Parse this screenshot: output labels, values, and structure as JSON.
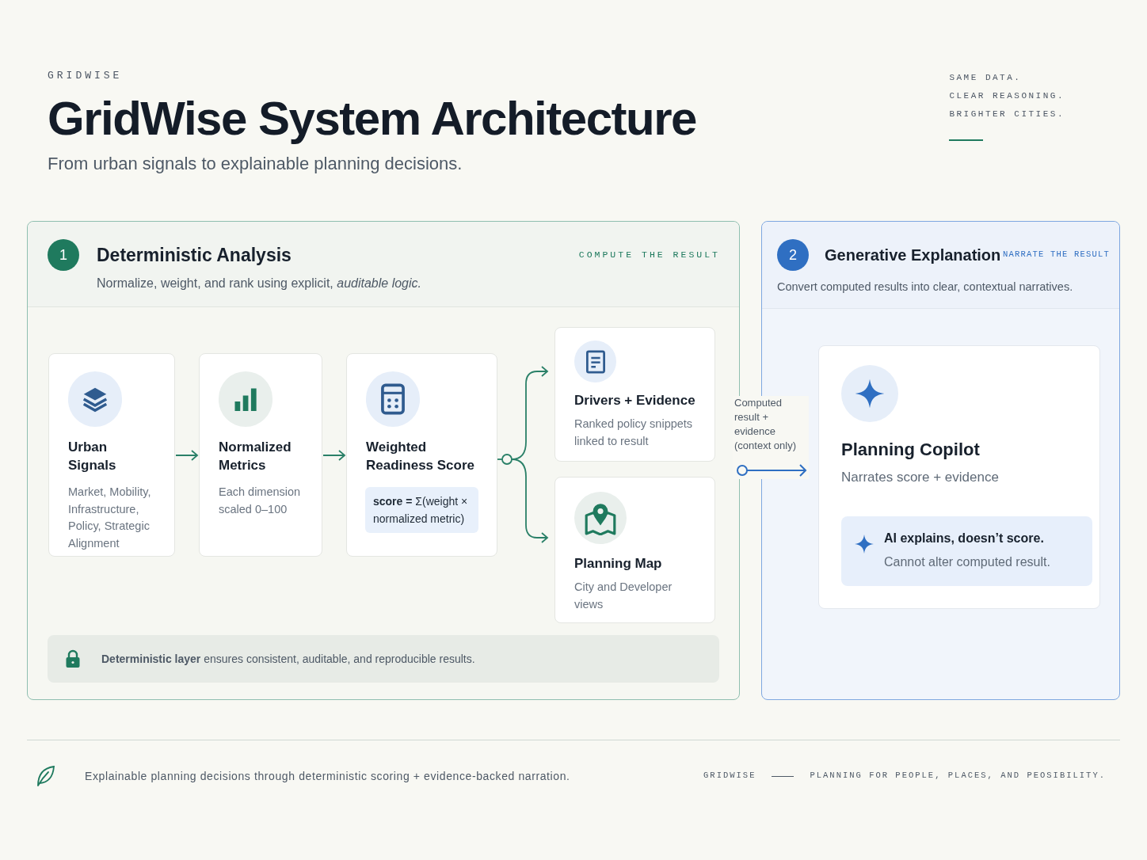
{
  "brand": "GRIDWISE",
  "title": "GridWise System Architecture",
  "subtitle": "From urban signals to explainable planning decisions.",
  "tagline": [
    "SAME DATA.",
    "CLEAR REASONING.",
    "BRIGHTER CITIES."
  ],
  "analysis": {
    "number": "1",
    "title": "Deterministic Analysis",
    "tag": "COMPUTE THE RESULT",
    "description": "Normalize, weight, and rank using explicit, *auditable logic.*",
    "steps": [
      {
        "title": "Urban Signals",
        "description": "Market, Mobility, Infrastructure, Policy, Strategic Alignment"
      },
      {
        "title": "Normalized Metrics",
        "description": "Each dimension scaled 0–100"
      },
      {
        "title": "Weighted Readiness Score",
        "formula": "**score =** Σ(weight × normalized metric)"
      }
    ],
    "outputs": [
      {
        "title": "Drivers + Evidence",
        "description": "Ranked policy snippets linked to result"
      },
      {
        "title": "Planning Map",
        "description": "City and Developer views"
      }
    ],
    "note": "**Deterministic layer** ensures consistent, auditable, and reproducible results."
  },
  "connector_label": "Computed result + evidence (context only)",
  "explanation": {
    "number": "2",
    "title": "Generative Explanation",
    "tag": "NARRATE THE RESULT",
    "description": "Convert computed results into clear, contextual narratives.",
    "copilot": {
      "title": "Planning Copilot",
      "description": "Narrates score + evidence",
      "note_title": "AI explains, doesn’t score.",
      "note_text": "Cannot alter computed result."
    }
  },
  "footer": {
    "text": "Explainable planning decisions through deterministic scoring + evidence-backed narration.",
    "brand": "GRIDWISE",
    "motto": "PLANNING FOR PEOPLE, PLACES, AND PEOSIBILITY."
  }
}
